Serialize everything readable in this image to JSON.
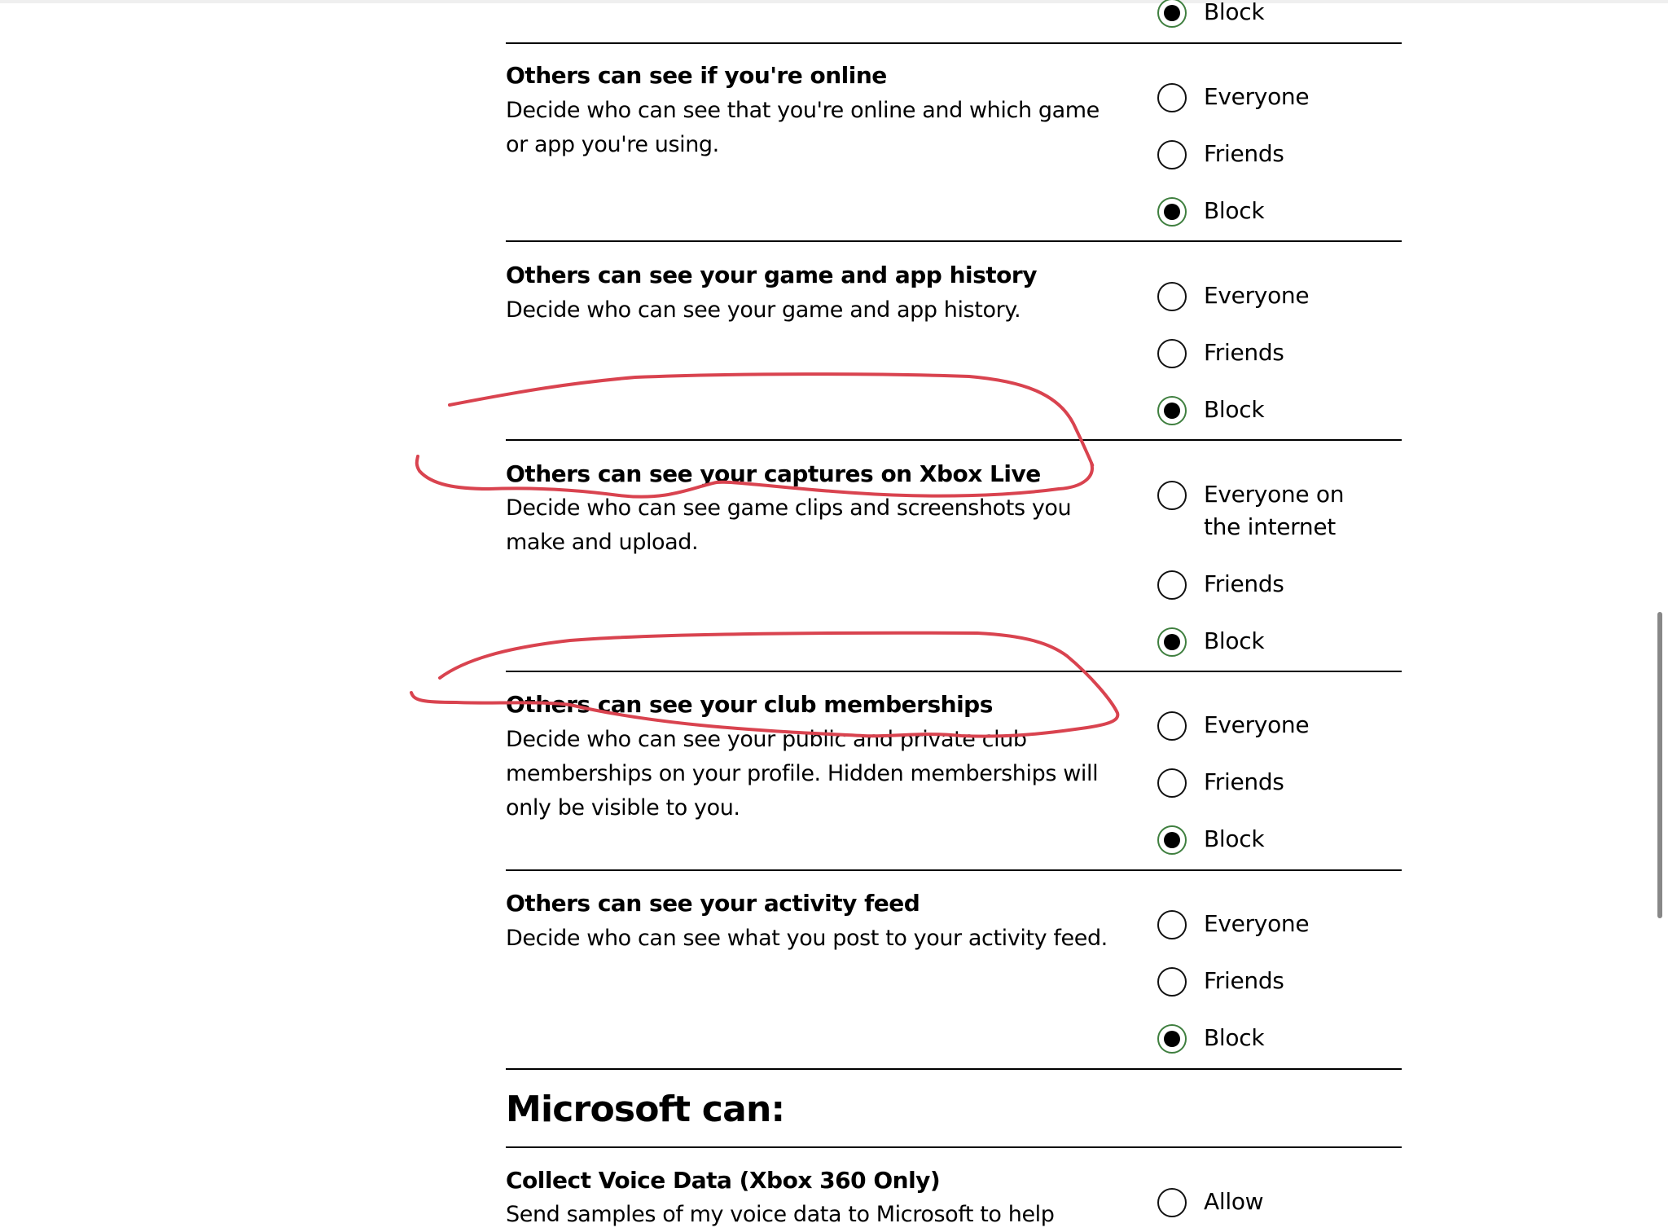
{
  "partial_top_option": {
    "label": "Block",
    "checked": true
  },
  "settings": [
    {
      "title": "Others can see if you're online",
      "description": "Decide who can see that you're online and which game or app you're using.",
      "options": [
        {
          "label": "Everyone",
          "checked": false
        },
        {
          "label": "Friends",
          "checked": false
        },
        {
          "label": "Block",
          "checked": true
        }
      ]
    },
    {
      "title": "Others can see your game and app history",
      "description": "Decide who can see your game and app history.",
      "options": [
        {
          "label": "Everyone",
          "checked": false
        },
        {
          "label": "Friends",
          "checked": false
        },
        {
          "label": "Block",
          "checked": true
        }
      ]
    },
    {
      "title": "Others can see your captures on Xbox Live",
      "description": "Decide who can see game clips and screenshots you make and upload.",
      "options": [
        {
          "label": "Everyone on\nthe internet",
          "checked": false
        },
        {
          "label": "Friends",
          "checked": false
        },
        {
          "label": "Block",
          "checked": true
        }
      ]
    },
    {
      "title": "Others can see your club memberships",
      "description": "Decide who can see your public and private club memberships on your profile. Hidden memberships will only be visible to you.",
      "options": [
        {
          "label": "Everyone",
          "checked": false
        },
        {
          "label": "Friends",
          "checked": false
        },
        {
          "label": "Block",
          "checked": true
        }
      ]
    },
    {
      "title": "Others can see your activity feed",
      "description": "Decide who can see what you post to your activity feed.",
      "options": [
        {
          "label": "Everyone",
          "checked": false
        },
        {
          "label": "Friends",
          "checked": false
        },
        {
          "label": "Block",
          "checked": true
        }
      ]
    }
  ],
  "microsoft_section": {
    "heading": "Microsoft can:",
    "settings": [
      {
        "title": "Collect Voice Data (Xbox 360 Only)",
        "description": "Send samples of my voice data to Microsoft to help",
        "options": [
          {
            "label": "Allow",
            "checked": false
          }
        ]
      }
    ]
  },
  "colors": {
    "selected_ring": "#3f7f3f",
    "annotation": "#d9434f",
    "divider": "#000000"
  },
  "annotations": [
    {
      "type": "freehand-loop",
      "target": "Others can see your captures on Xbox Live"
    },
    {
      "type": "freehand-loop",
      "target": "Others can see your club memberships"
    }
  ]
}
